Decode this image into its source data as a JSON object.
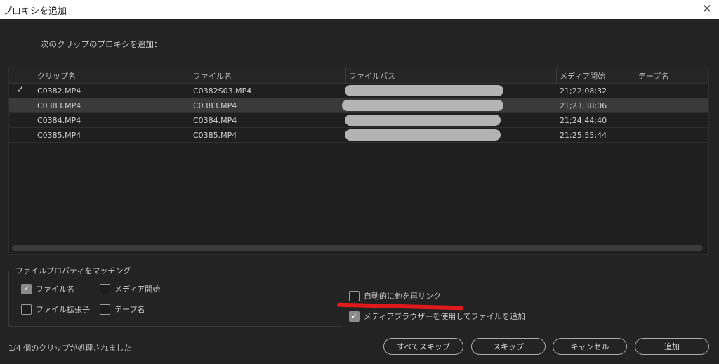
{
  "window": {
    "title": "プロキシを追加",
    "close_icon": "close-icon"
  },
  "subtitle": "次のクリップのプロキシを追加：",
  "table": {
    "headers": [
      "クリップ名",
      "ファイル名",
      "ファイルパス",
      "メディア開始",
      "テープ名"
    ],
    "rows": [
      {
        "checked": true,
        "clip": "C0382.MP4",
        "file": "C0382S03.MP4",
        "path": "",
        "start": "21;22;08;32",
        "tape": ""
      },
      {
        "checked": false,
        "clip": "C0383.MP4",
        "file": "C0383.MP4",
        "path": "",
        "start": "21;23;38;06",
        "tape": ""
      },
      {
        "checked": false,
        "clip": "C0384.MP4",
        "file": "C0384.MP4",
        "path": "",
        "start": "21;24;44;40",
        "tape": ""
      },
      {
        "checked": false,
        "clip": "C0385.MP4",
        "file": "C0385.MP4",
        "path": "",
        "start": "21;25;55;44",
        "tape": ""
      }
    ],
    "selected_row": 1
  },
  "match_group": {
    "legend": "ファイルプロパティをマッチング",
    "options": {
      "filename": {
        "label": "ファイル名",
        "checked": true
      },
      "media_start": {
        "label": "メディア開始",
        "checked": false
      },
      "extension": {
        "label": "ファイル拡張子",
        "checked": false
      },
      "tape_name": {
        "label": "テープ名",
        "checked": false
      }
    }
  },
  "auto_relink": {
    "label": "自動的に他を再リンク",
    "checked": false
  },
  "media_browser": {
    "label": "メディアブラウザーを使用してファイルを追加",
    "checked": true
  },
  "status": "1/4 個のクリップが処理されました",
  "buttons": {
    "skip_all": "すべてスキップ",
    "skip": "スキップ",
    "cancel": "キャンセル",
    "add": "追加"
  },
  "colors": {
    "background": "#232323",
    "annotation": "#e01a1a"
  }
}
